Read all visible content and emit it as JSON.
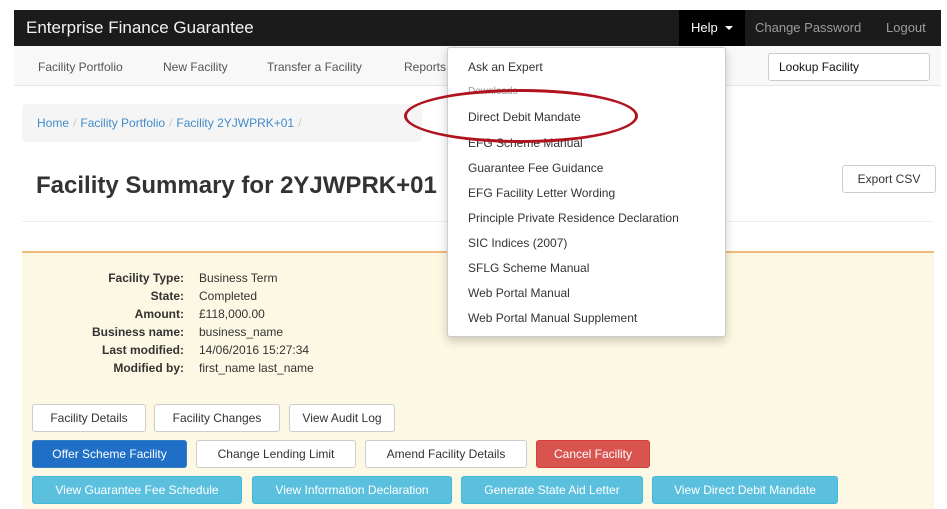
{
  "navbar": {
    "brand": "Enterprise Finance Guarantee",
    "help": "Help",
    "change_password": "Change Password",
    "logout": "Logout"
  },
  "subnav": {
    "items": [
      "Facility Portfolio",
      "New Facility",
      "Transfer a Facility",
      "Reports"
    ],
    "lookup_placeholder": "Lookup Facility"
  },
  "breadcrumb": [
    "Home",
    "Facility Portfolio",
    "Facility 2YJWPRK+01"
  ],
  "page": {
    "title": "Facility Summary for 2YJWPRK+01",
    "export_csv": "Export CSV"
  },
  "summary": {
    "rows": [
      {
        "label": "Facility Type:",
        "value": "Business Term"
      },
      {
        "label": "State:",
        "value": "Completed"
      },
      {
        "label": "Amount:",
        "value": "£118,000.00"
      },
      {
        "label": "Business name:",
        "value": "business_name"
      },
      {
        "label": "Last modified:",
        "value": "14/06/2016 15:27:34"
      },
      {
        "label": "Modified by:",
        "value": "first_name last_name"
      }
    ]
  },
  "buttons": {
    "facility_details": "Facility Details",
    "facility_changes": "Facility Changes",
    "view_audit_log": "View Audit Log",
    "offer_scheme_facility": "Offer Scheme Facility",
    "change_lending_limit": "Change Lending Limit",
    "amend_facility_details": "Amend Facility Details",
    "cancel_facility": "Cancel Facility",
    "view_guarantee_fee_schedule": "View Guarantee Fee Schedule",
    "view_information_declaration": "View Information Declaration",
    "generate_state_aid_letter": "Generate State Aid Letter",
    "view_direct_debit_mandate": "View Direct Debit Mandate"
  },
  "help_menu": {
    "ask_expert": "Ask an Expert",
    "downloads_header": "Downloads",
    "items": [
      "Direct Debit Mandate",
      "EFG Scheme Manual",
      "Guarantee Fee Guidance",
      "EFG Facility Letter Wording",
      "Principle Private Residence Declaration",
      "SIC Indices (2007)",
      "SFLG Scheme Manual",
      "Web Portal Manual",
      "Web Portal Manual Supplement"
    ]
  },
  "colors": {
    "navbar": "#1b1b1b",
    "panel": "#fcf8e3",
    "primary": "#1f6fc7",
    "danger": "#d9534f",
    "info": "#5bc0de",
    "annotation": "#b0141e"
  }
}
